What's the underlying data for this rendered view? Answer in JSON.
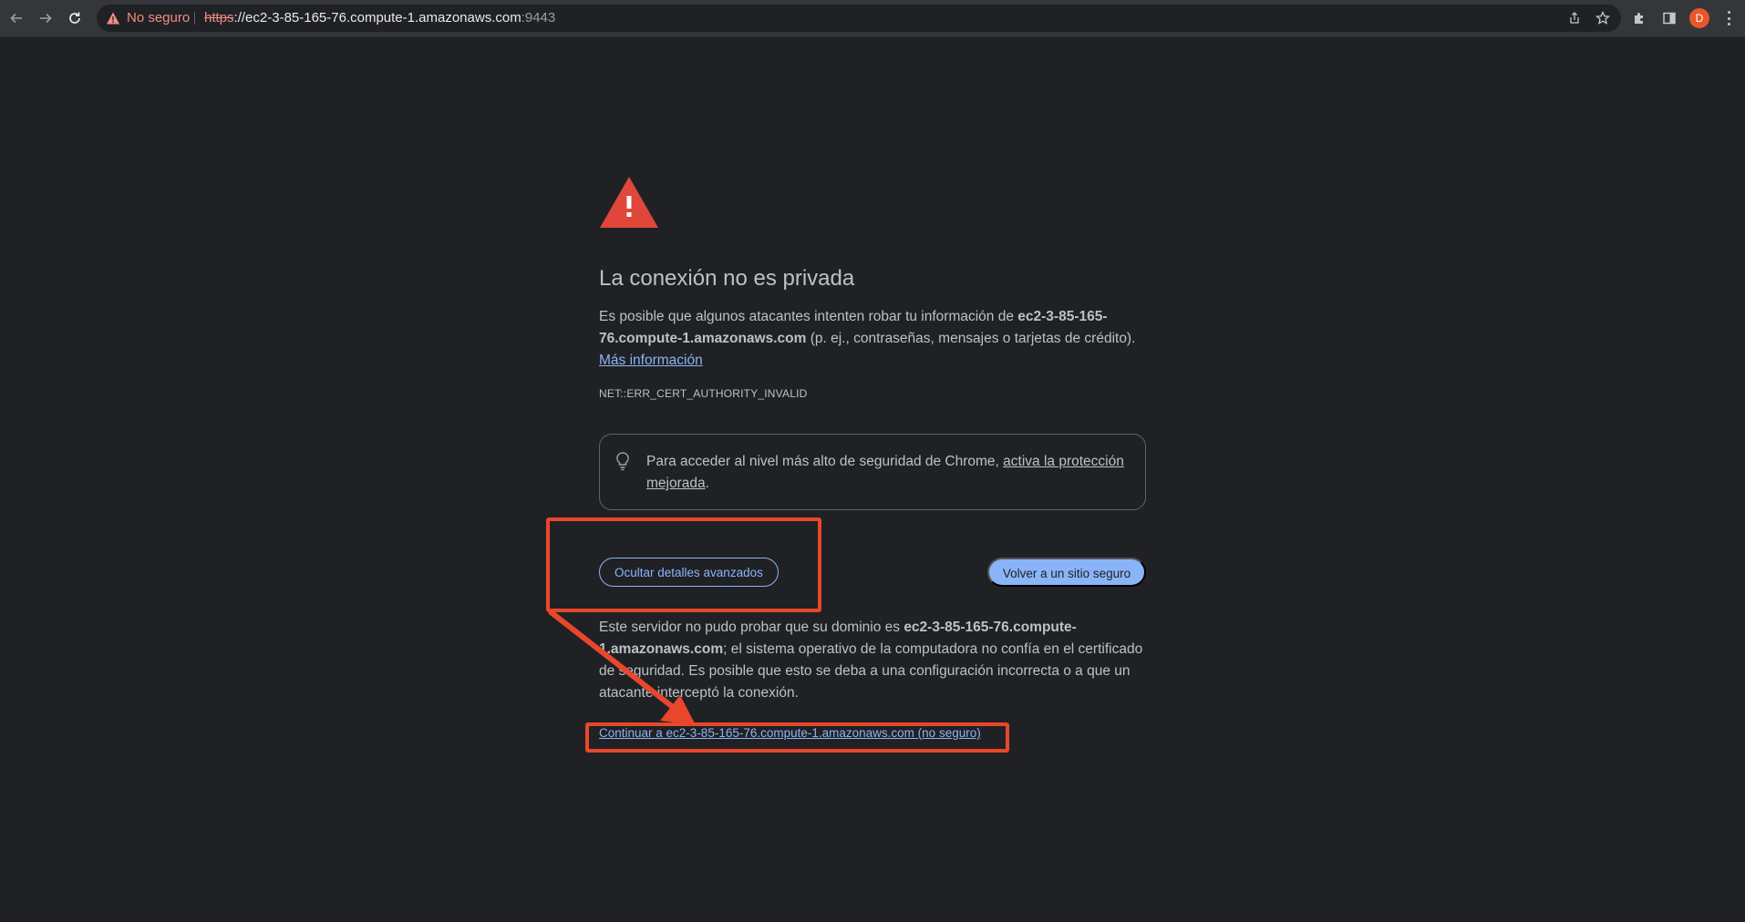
{
  "browser": {
    "security_label": "No seguro",
    "url_scheme": "https",
    "url_separator": "://",
    "url_host": "ec2-3-85-165-76.compute-1.amazonaws.com",
    "url_port": ":9443",
    "profile_initial": "D"
  },
  "page": {
    "title": "La conexión no es privada",
    "intro_1": "Es posible que algunos atacantes intenten robar tu información de ",
    "intro_host": "ec2-3-85-165-76.compute-1.amazonaws.com",
    "intro_2": " (p. ej., contraseñas, mensajes o tarjetas de crédito).",
    "more_info_link": "Más información",
    "error_code": "NET::ERR_CERT_AUTHORITY_INVALID",
    "tip_text": "Para acceder al nivel más alto de seguridad de Chrome, ",
    "tip_link": "activa la protección mejorada",
    "tip_end": ".",
    "hide_details_button": "Ocultar detalles avanzados",
    "back_to_safety_button": "Volver a un sitio seguro",
    "details_1": "Este servidor no pudo probar que su dominio es ",
    "details_host": "ec2-3-85-165-76.compute-1.amazonaws.com",
    "details_2": "; el sistema operativo de la computadora no confía en el certificado de seguridad. Es posible que esto se deba a una configuración incorrecta o a que un atacante interceptó la conexión.",
    "proceed_link": "Continuar a ec2-3-85-165-76.compute-1.amazonaws.com (no seguro)"
  },
  "colors": {
    "annotation": "#e8472b",
    "warning_red": "#e0463a",
    "link_blue": "#8ab4f8"
  }
}
